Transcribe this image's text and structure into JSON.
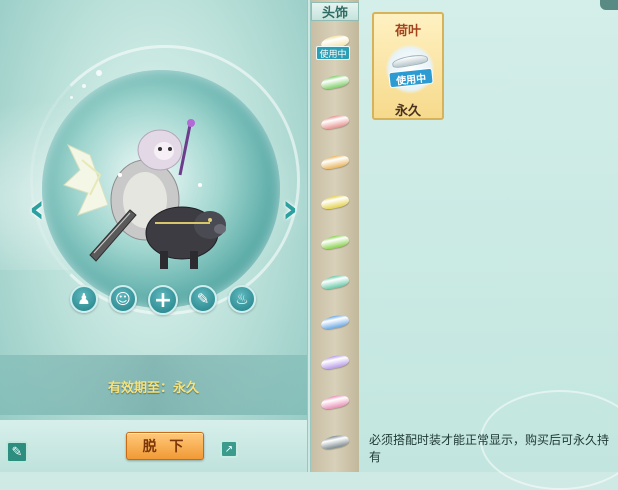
{
  "slot_panel": {
    "header": "头饰",
    "in_use_tag": "使用中",
    "slots": [
      {
        "color": "#f3e3a4"
      },
      {
        "color": "#7fcf6a"
      },
      {
        "color": "#e7928f"
      },
      {
        "color": "#e9b55c"
      },
      {
        "color": "#e4d24d"
      },
      {
        "color": "#89d24c"
      },
      {
        "color": "#67c9a8"
      },
      {
        "color": "#6aa8e6"
      },
      {
        "color": "#b79be8"
      },
      {
        "color": "#e88fb4"
      },
      {
        "color": "#7c8a8f"
      }
    ]
  },
  "preview": {
    "actions": [
      {
        "icon": "person-icon",
        "glyph": "♟"
      },
      {
        "icon": "character-icon",
        "glyph": "☺"
      },
      {
        "icon": "plus-icon",
        "glyph": "+"
      },
      {
        "icon": "dye-icon",
        "glyph": "✎"
      },
      {
        "icon": "outfit-icon",
        "glyph": "♨"
      }
    ],
    "validity_text": "有效期至：永久",
    "remove_button": "脱 下"
  },
  "item": {
    "name": "荷叶",
    "tag": "使用中",
    "duration": "永久"
  },
  "footer_note": "必须搭配时装才能正常显示，购买后可永久持有",
  "colors": {
    "accent": "#2ba0a0",
    "remove_button": "#f19a35",
    "validity_text": "#f7e37a"
  }
}
